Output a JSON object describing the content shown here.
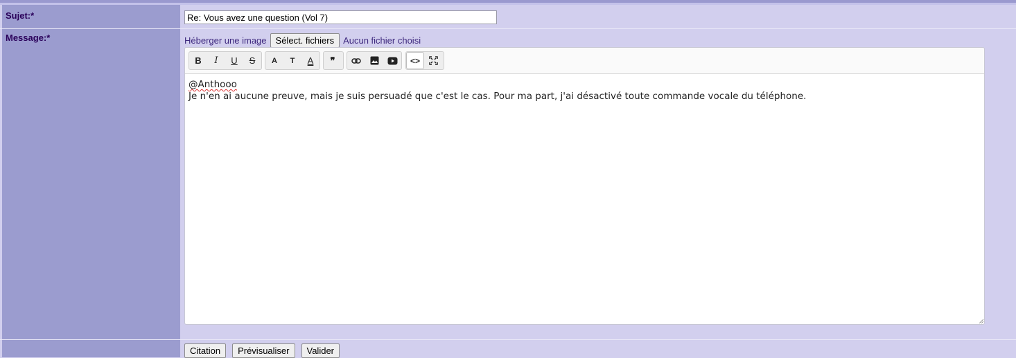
{
  "form": {
    "subject_label": "Sujet:*",
    "subject_value": "Re: Vous avez une question (Vol 7)",
    "message_label": "Message:*",
    "upload_label": "Héberger une image",
    "file_button": "Sélect. fichiers",
    "file_status": "Aucun fichier choisi"
  },
  "toolbar": {
    "bold": "B",
    "italic": "I",
    "underline": "U",
    "strike": "S",
    "font": "A",
    "size": "T",
    "color": "A",
    "quote": "❞",
    "link": "🔗",
    "image": "▣",
    "video": "▶",
    "source": "<>",
    "fullscreen": "⛶"
  },
  "editor": {
    "mention": "@Anthooo",
    "body": "Je n'en ai aucune preuve, mais je suis persuadé que c'est le cas. Pour ma part, j'ai désactivé toute commande vocale du téléphone."
  },
  "buttons": {
    "quote": "Citation",
    "preview": "Prévisualiser",
    "submit": "Valider"
  },
  "colors": {
    "left_column": "#9b9ccf",
    "right_background": "#d2cfee",
    "label_text": "#2a005a"
  },
  "icons": [
    "bold-icon",
    "italic-icon",
    "underline-icon",
    "strikethrough-icon",
    "font-icon",
    "text-size-icon",
    "text-color-icon",
    "quote-icon",
    "link-icon",
    "image-icon",
    "video-icon",
    "source-code-icon",
    "fullscreen-icon"
  ]
}
